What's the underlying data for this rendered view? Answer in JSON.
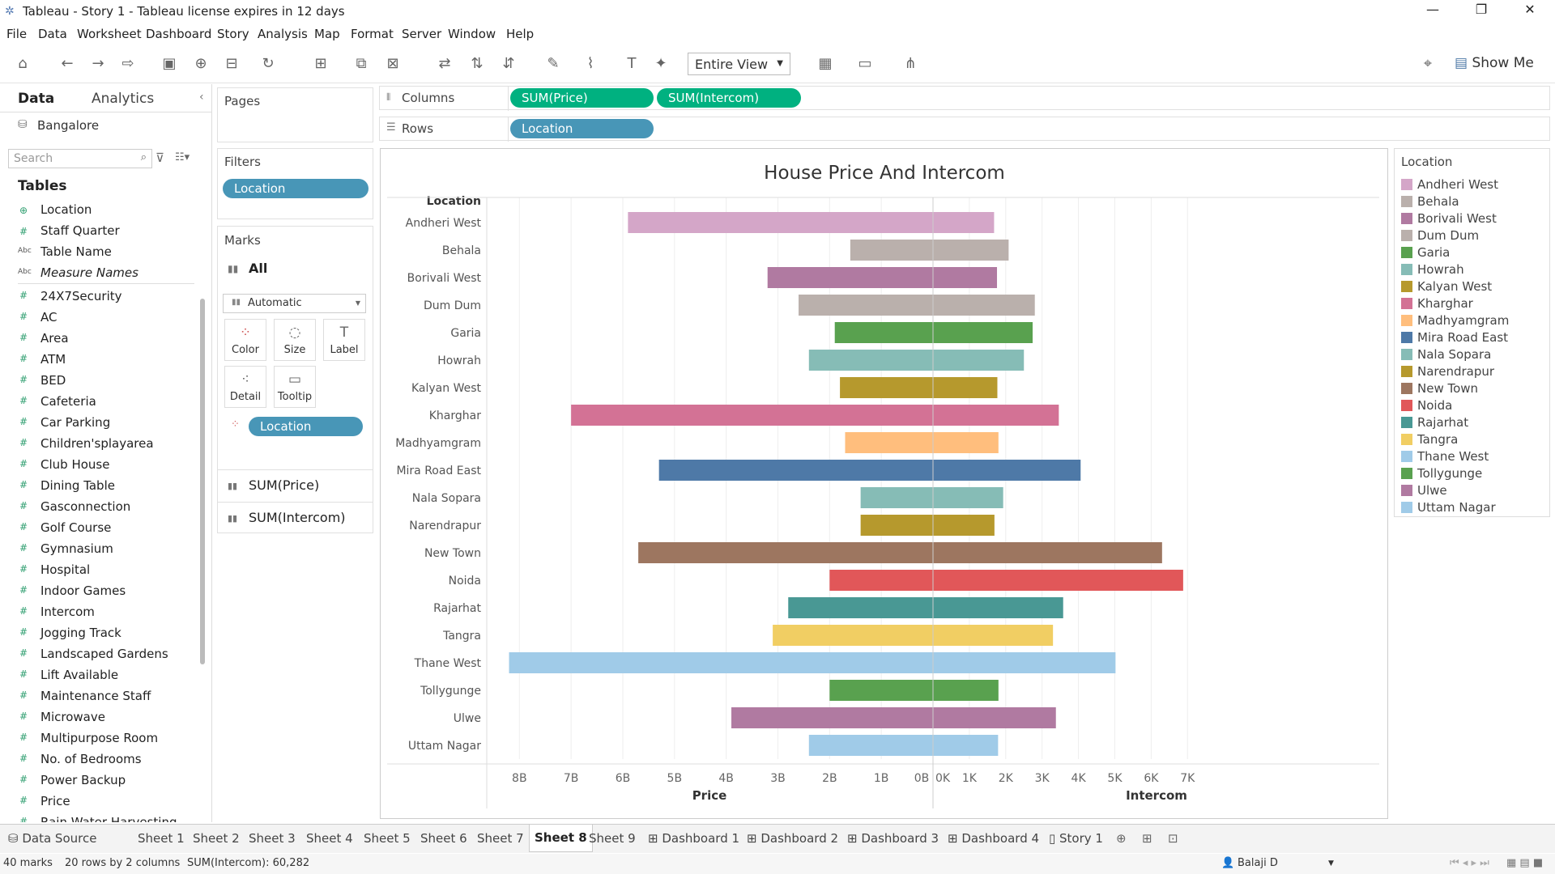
{
  "window": {
    "title": "Tableau - Story 1 - Tableau license expires in 12 days"
  },
  "menu": [
    "File",
    "Data",
    "Worksheet",
    "Dashboard",
    "Story",
    "Analysis",
    "Map",
    "Format",
    "Server",
    "Window",
    "Help"
  ],
  "toolbar": {
    "view_select": "Entire View",
    "show_me": "Show Me"
  },
  "data_pane": {
    "tabs": [
      "Data",
      "Analytics"
    ],
    "datasource": "Bangalore",
    "search_placeholder": "Search",
    "tables_header": "Tables",
    "dimensions": [
      {
        "name": "Location",
        "icon": "globe"
      },
      {
        "name": "Staff Quarter",
        "icon": "hash"
      },
      {
        "name": "Table Name",
        "icon": "abc"
      },
      {
        "name": "Measure Names",
        "icon": "abc"
      }
    ],
    "measures": [
      "24X7Security",
      "AC",
      "Area",
      "ATM",
      "BED",
      "Cafeteria",
      "Car Parking",
      "Children'splayarea",
      "Club House",
      "Dining Table",
      "Gasconnection",
      "Golf Course",
      "Gymnasium",
      "Hospital",
      "Indoor Games",
      "Intercom",
      "Jogging Track",
      "Landscaped Gardens",
      "Lift Available",
      "Maintenance Staff",
      "Microwave",
      "Multipurpose Room",
      "No. of Bedrooms",
      "Power Backup",
      "Price",
      "Rain Water Harvesting"
    ]
  },
  "shelves": {
    "pages": "Pages",
    "filters": "Filters",
    "filter_pill": "Location",
    "marks": "Marks",
    "marks_all": "All",
    "mark_type": "Automatic",
    "mark_buttons": [
      "Color",
      "Size",
      "Label",
      "Detail",
      "Tooltip"
    ],
    "color_pill": "Location",
    "marks_measures": [
      "SUM(Price)",
      "SUM(Intercom)"
    ],
    "columns_label": "Columns",
    "columns": [
      "SUM(Price)",
      "SUM(Intercom)"
    ],
    "rows_label": "Rows",
    "rows": [
      "Location"
    ]
  },
  "chart_data": {
    "type": "bar",
    "title": "House Price And Intercom",
    "row_header": "Location",
    "categories": [
      "Andheri West",
      "Behala",
      "Borivali West",
      "Dum Dum",
      "Garia",
      "Howrah",
      "Kalyan West",
      "Kharghar",
      "Madhyamgram",
      "Mira Road East",
      "Nala Sopara",
      "Narendrapur",
      "New Town",
      "Noida",
      "Rajarhat",
      "Tangra",
      "Thane West",
      "Tollygunge",
      "Ulwe",
      "Uttam Nagar"
    ],
    "colors": [
      "#d4a6c8",
      "#bab0ac",
      "#b07aa1",
      "#bab0ac",
      "#59a14f",
      "#86bcb6",
      "#b6992d",
      "#d37295",
      "#ffbe7d",
      "#4e79a7",
      "#86bcb6",
      "#b6992d",
      "#9d7660",
      "#e15759",
      "#499894",
      "#f1ce63",
      "#a0cbe8",
      "#59a14f",
      "#b07aa1",
      "#a0cbe8"
    ],
    "series": [
      {
        "name": "Price",
        "values": [
          5.9,
          1.6,
          3.2,
          2.6,
          1.9,
          2.4,
          1.8,
          7.0,
          1.7,
          5.3,
          1.4,
          1.4,
          5.7,
          2.0,
          2.8,
          3.1,
          8.2,
          2.0,
          3.9,
          2.4
        ]
      },
      {
        "name": "Intercom",
        "values": [
          1680,
          2080,
          1760,
          2800,
          2740,
          2500,
          1770,
          3460,
          1800,
          4060,
          1930,
          1690,
          6300,
          6880,
          3580,
          3300,
          5020,
          1800,
          3380,
          1790
        ]
      }
    ],
    "price_axis": {
      "label": "Price",
      "ticks": [
        "8B",
        "7B",
        "6B",
        "5B",
        "4B",
        "3B",
        "2B",
        "1B",
        "0B"
      ],
      "max": 8.6
    },
    "intercom_axis": {
      "label": "Intercom",
      "ticks": [
        "0K",
        "1K",
        "2K",
        "3K",
        "4K",
        "5K",
        "6K",
        "7K"
      ],
      "max": 7150
    }
  },
  "legend": {
    "title": "Location"
  },
  "sheet_tabs": [
    "Data Source",
    "Sheet 1",
    "Sheet 2",
    "Sheet 3",
    "Sheet 4",
    "Sheet 5",
    "Sheet 6",
    "Sheet 7",
    "Sheet 8",
    "Sheet 9",
    "Dashboard 1",
    "Dashboard 2",
    "Dashboard 3",
    "Dashboard 4",
    "Story 1"
  ],
  "active_tab": "Sheet 8",
  "status": {
    "marks": "40 marks",
    "rows_cols": "20 rows by 2 columns",
    "sum": "SUM(Intercom): 60,282",
    "user": "Balaji D"
  }
}
